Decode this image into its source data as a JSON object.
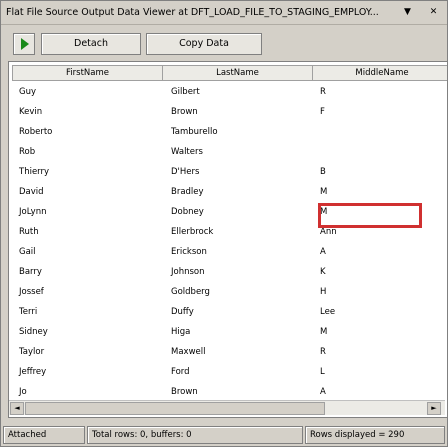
{
  "window": {
    "title": "Flat File Source Output Data Viewer at DFT_LOAD_FILE_TO_STAGING_EMPLOY...",
    "dropdown_glyph": "▼",
    "close_glyph": "✕"
  },
  "toolbar": {
    "play_icon": "play-icon",
    "detach_label": "Detach",
    "copy_label": "Copy Data"
  },
  "grid": {
    "columns": [
      "FirstName",
      "LastName",
      "MiddleName"
    ],
    "rows": [
      [
        "Guy",
        "Gilbert",
        "R"
      ],
      [
        "Kevin",
        "Brown",
        "F"
      ],
      [
        "Roberto",
        "Tamburello",
        ""
      ],
      [
        "Rob",
        "Walters",
        ""
      ],
      [
        "Thierry",
        "D'Hers",
        "B"
      ],
      [
        "David",
        "Bradley",
        "M"
      ],
      [
        "JoLynn",
        "Dobney",
        "M"
      ],
      [
        "Ruth",
        "Ellerbrock",
        "Ann"
      ],
      [
        "Gail",
        "Erickson",
        "A"
      ],
      [
        "Barry",
        "Johnson",
        "K"
      ],
      [
        "Jossef",
        "Goldberg",
        "H"
      ],
      [
        "Terri",
        "Duffy",
        "Lee"
      ],
      [
        "Sidney",
        "Higa",
        "M"
      ],
      [
        "Taylor",
        "Maxwell",
        "R"
      ],
      [
        "Jeffrey",
        "Ford",
        "L"
      ],
      [
        "Jo",
        "Brown",
        "A"
      ]
    ],
    "scroll_left": "◄",
    "scroll_right": "►"
  },
  "status": {
    "state": "Attached",
    "totals": "Total rows: 0, buffers: 0",
    "displayed": "Rows displayed = 290"
  },
  "colors": {
    "highlight": "#d03030",
    "play": "#1a8a1a"
  }
}
